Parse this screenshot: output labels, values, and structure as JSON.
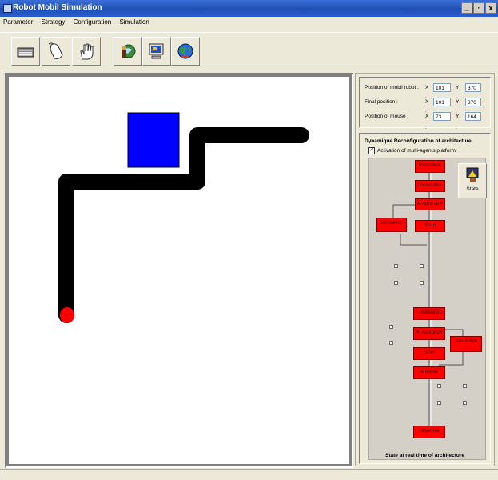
{
  "window": {
    "title": "Robot Mobil Simulation",
    "controls": [
      "_",
      "·",
      "x"
    ]
  },
  "menu": [
    "Parameter",
    "Strategy",
    "Configuration",
    "Simulation"
  ],
  "toolbar": [
    "keyboard-icon",
    "mouse-icon",
    "hand-icon",
    "globe-person-icon",
    "monitor-icon",
    "earth-icon"
  ],
  "positions": {
    "robot": {
      "label": "Position of mobil robot :",
      "x_label": "X :",
      "x": "101",
      "y_label": "Y :",
      "y": "370"
    },
    "final": {
      "label": "Final position :",
      "x_label": "X :",
      "x": "101",
      "y_label": "Y :",
      "y": "370"
    },
    "mouse": {
      "label": "Position of mouse :",
      "x_label": "X :",
      "x": "73",
      "y_label": "Y :",
      "y": "164"
    }
  },
  "architecture": {
    "title": "Dynamique Reconfiguration of architecture",
    "checkbox_label": "Activation of multi-agents platform",
    "checkbox_checked": true,
    "state_button": "State",
    "footer": "State at real time of architecture",
    "upper_blocks": [
      "Parameter",
      "Localisation",
      "K-Approach",
      "Simulation",
      "Scan"
    ],
    "lower_blocks": [
      "Localisation",
      "K-Approach",
      "Simulation",
      "Scan",
      "Analysis",
      "Objective"
    ]
  },
  "colors": {
    "robot": "#ff0000",
    "obstacle": "#0000ff",
    "path": "#000000",
    "agent": "#ff0000"
  }
}
